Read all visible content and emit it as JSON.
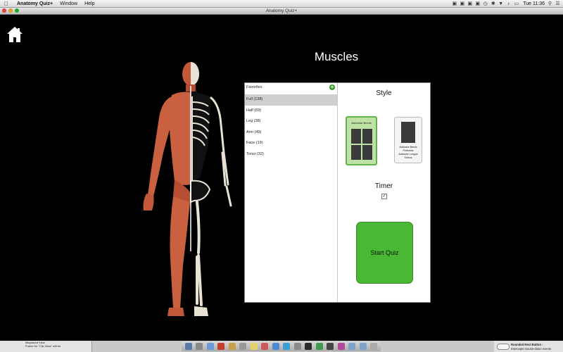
{
  "menubar": {
    "app_name": "Anatomy Quiz+",
    "items": [
      "Window",
      "Help"
    ],
    "clock": "Tue 11:36"
  },
  "window": {
    "title": "Anatomy Quiz+"
  },
  "heading": "Muscles",
  "categories": {
    "header": "Favorites",
    "items": [
      {
        "label": "Full (138)",
        "selected": true
      },
      {
        "label": "Half (69)",
        "selected": false
      },
      {
        "label": "Leg (38)",
        "selected": false
      },
      {
        "label": "Arm (49)",
        "selected": false
      },
      {
        "label": "Face (19)",
        "selected": false
      },
      {
        "label": "Torso (32)",
        "selected": false
      }
    ]
  },
  "style": {
    "title": "Style",
    "card1_title": "Adductor Brevis",
    "card2_labels": [
      "Adductor Brevis",
      "Piriformis",
      "Adductor Longus",
      "Soleus"
    ]
  },
  "timer": {
    "title": "Timer",
    "checked": true
  },
  "start_button": "Start Quiz",
  "bottom_left": {
    "lines": [
      "",
      "Misplaced View",
      "Frame for \"Clip View\" will be"
    ]
  },
  "bottom_right": {
    "title": "Rounded Rect Button -",
    "subtitle": "Intercepts mouse-down events"
  },
  "colors": {
    "accent_green": "#49b834",
    "background": "#000000"
  }
}
